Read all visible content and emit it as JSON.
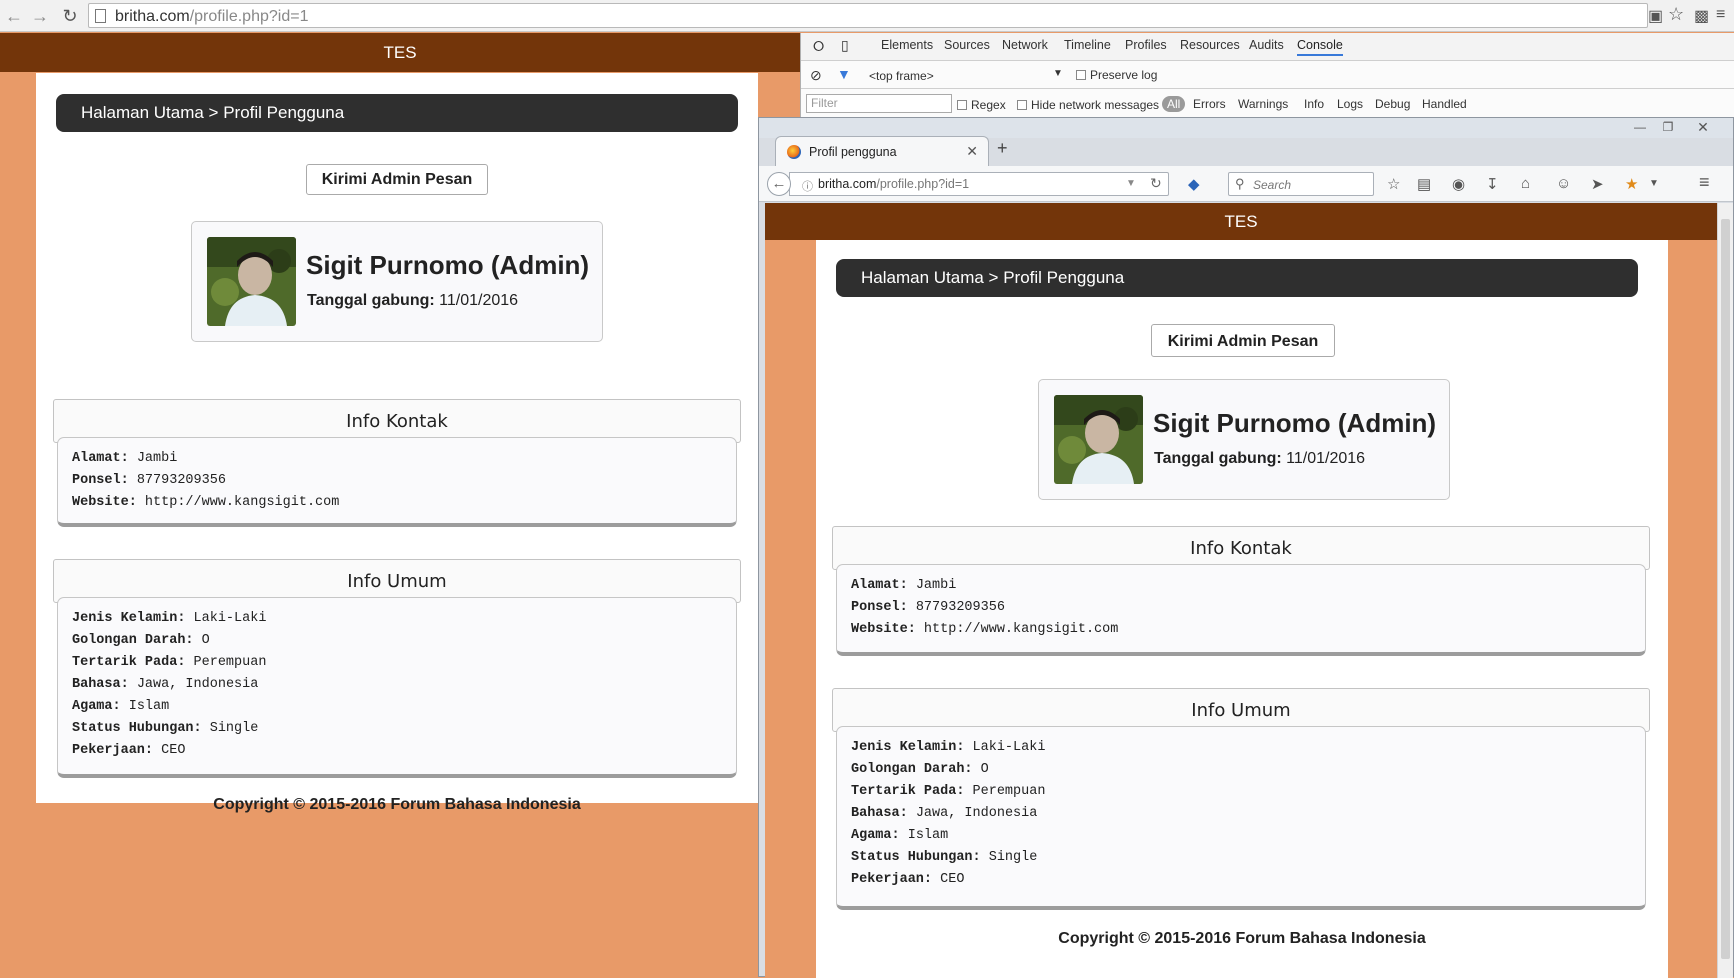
{
  "chrome": {
    "url_host": "britha.com",
    "url_path": "/profile.php?id=1"
  },
  "site": {
    "header_title": "TES",
    "breadcrumb": "Halaman Utama > Profil Pengguna",
    "message_button": "Kirimi Admin Pesan",
    "profile": {
      "name": "Sigit Purnomo (Admin)",
      "join_label": "Tanggal gabung:",
      "join_value": "11/01/2016"
    },
    "contact": {
      "title": "Info Kontak",
      "rows": [
        {
          "label": "Alamat:",
          "value": "Jambi"
        },
        {
          "label": "Ponsel:",
          "value": "87793209356"
        },
        {
          "label": "Website:",
          "value": "http://www.kangsigit.com"
        }
      ]
    },
    "general": {
      "title": "Info Umum",
      "rows": [
        {
          "label": "Jenis Kelamin:",
          "value": "Laki-Laki"
        },
        {
          "label": "Golongan Darah:",
          "value": "O"
        },
        {
          "label": "Tertarik Pada:",
          "value": "Perempuan"
        },
        {
          "label": "Bahasa:",
          "value": "Jawa, Indonesia"
        },
        {
          "label": "Agama:",
          "value": "Islam"
        },
        {
          "label": "Status Hubungan:",
          "value": "Single"
        },
        {
          "label": "Pekerjaan:",
          "value": "CEO"
        }
      ]
    },
    "copyright": "Copyright © 2015-2016 Forum Bahasa Indonesia"
  },
  "devtools": {
    "tabs": [
      "Elements",
      "Sources",
      "Network",
      "Timeline",
      "Profiles",
      "Resources",
      "Audits",
      "Console"
    ],
    "active_tab": "Console",
    "frame_select": "<top frame>",
    "preserve_log": "Preserve log",
    "filter_placeholder": "Filter",
    "regex": "Regex",
    "hide_network": "Hide network messages",
    "all": "All",
    "levels": [
      "Errors",
      "Warnings",
      "Info",
      "Logs",
      "Debug",
      "Handled"
    ]
  },
  "firefox": {
    "tab_title": "Profil pengguna",
    "url_host": "britha.com",
    "url_path": "/profile.php?id=1",
    "search_placeholder": "Search"
  },
  "colors": {
    "header_brown": "#73350a",
    "page_bg_orange": "#e89a68",
    "breadcrumb_dark": "#2f2f2f"
  }
}
